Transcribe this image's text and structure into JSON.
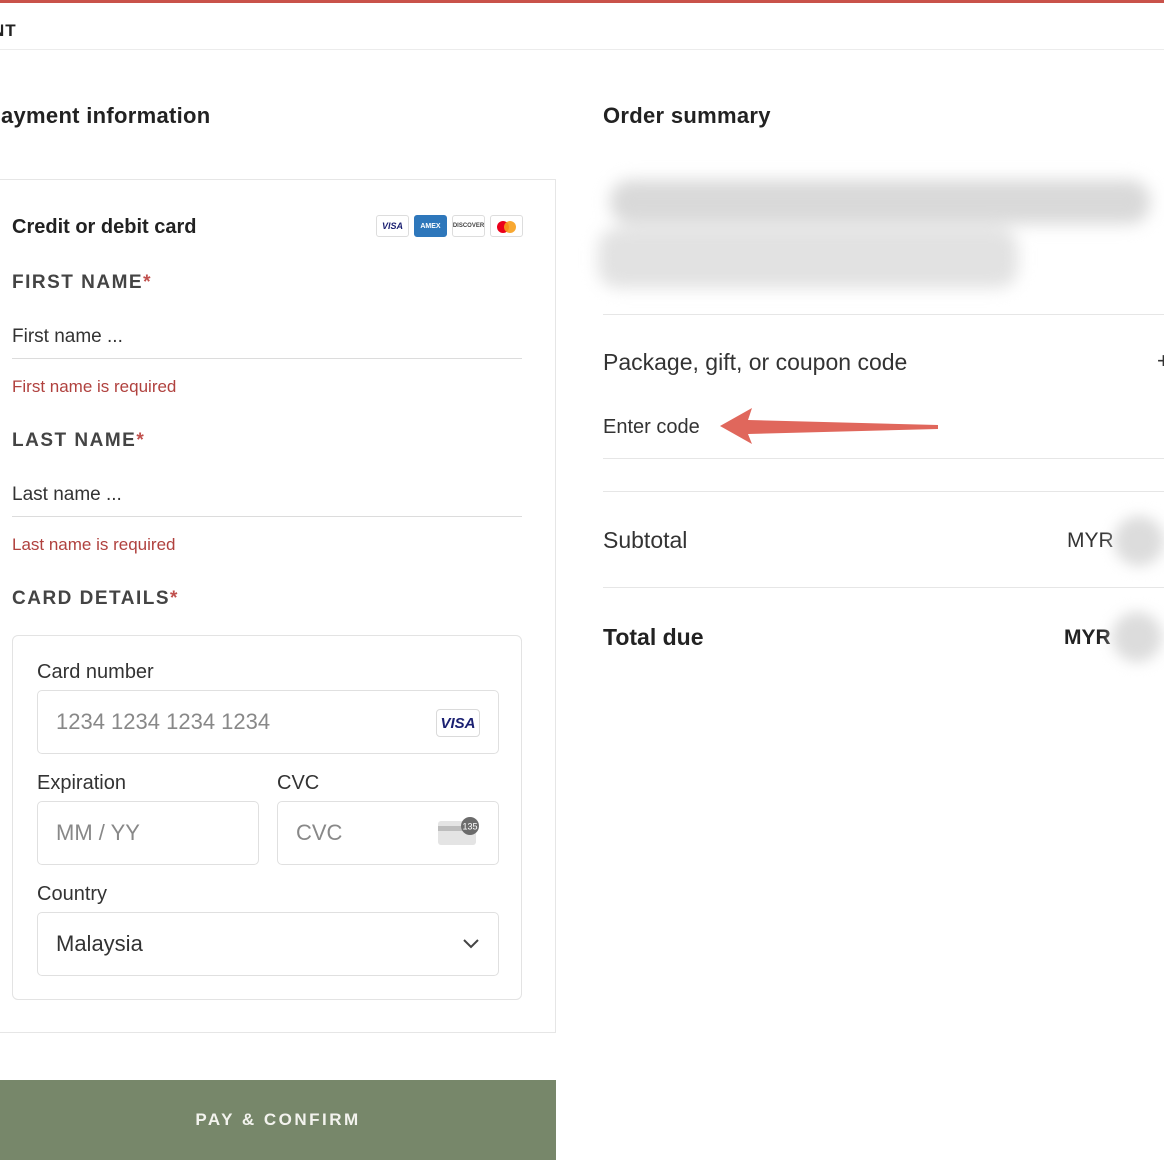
{
  "header": {
    "label": "NT",
    "accent_color": "#c9524a"
  },
  "payment": {
    "title": "Payment information",
    "card_heading": "Credit or debit card",
    "brands": [
      "visa",
      "amex",
      "discover",
      "mastercard"
    ],
    "brand_labels": {
      "visa": "VISA",
      "amex": "AMEX",
      "discover": "DISCOVER"
    },
    "first_name": {
      "label": "FIRST NAME",
      "required_mark": "*",
      "placeholder": "First name ...",
      "error": "First name is required"
    },
    "last_name": {
      "label": "LAST NAME",
      "required_mark": "*",
      "placeholder": "Last name ...",
      "error": "Last name is required"
    },
    "card_details": {
      "label": "CARD DETAILS",
      "required_mark": "*",
      "card_number_label": "Card number",
      "card_number_placeholder": "1234 1234 1234 1234",
      "card_badge": "VISA",
      "expiration_label": "Expiration",
      "expiration_placeholder": "MM / YY",
      "cvc_label": "CVC",
      "cvc_placeholder": "CVC",
      "cvc_icon_text": "135",
      "country_label": "Country",
      "country_value": "Malaysia"
    },
    "pay_button": "PAY & CONFIRM",
    "button_color": "#77876a",
    "error_color": "#b0413e"
  },
  "order": {
    "title": "Order summary",
    "coupon_label": "Package, gift, or coupon code",
    "coupon_toggle": "+",
    "coupon_placeholder": "Enter code",
    "annotation_arrow_color": "#e0675c",
    "subtotal_label": "Subtotal",
    "subtotal_currency": "MYR",
    "total_label": "Total due",
    "total_currency": "MYR"
  }
}
